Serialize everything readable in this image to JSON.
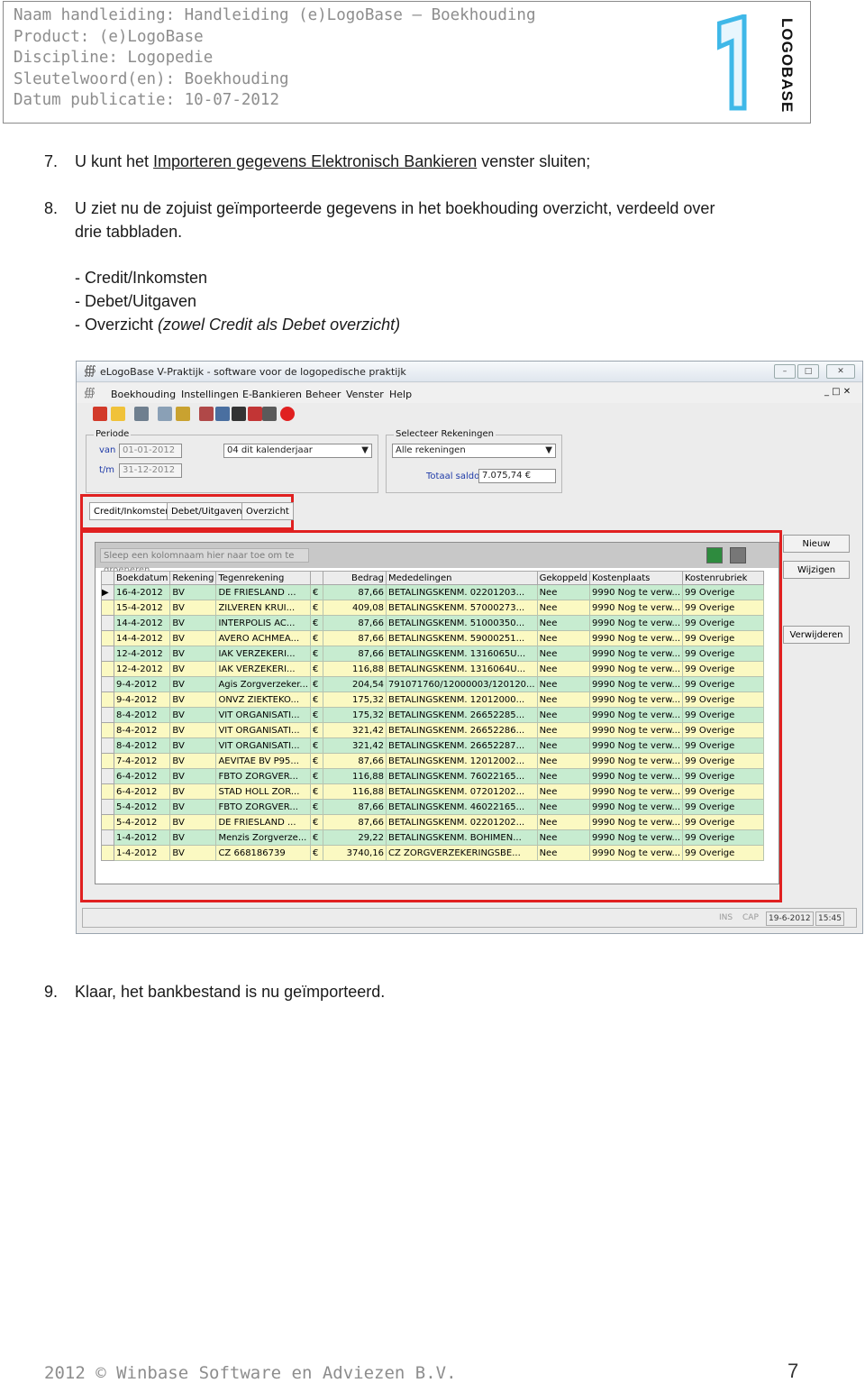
{
  "header": {
    "lines": [
      "Naam handleiding: Handleiding (e)LogoBase – Boekhouding",
      "Product: (e)LogoBase",
      "Discipline: Logopedie",
      "Sleutelwoord(en): Boekhouding",
      "Datum publicatie: 10-07-2012"
    ],
    "logo_text": "LOGOBASE"
  },
  "steps": {
    "s7_num": "7.",
    "s7_a": "U kunt het ",
    "s7_link": "Importeren gegevens Elektronisch Bankieren",
    "s7_b": " venster sluiten;",
    "s8_num": "8.",
    "s8_line1": "U ziet nu de zojuist geïmporteerde gegevens in het boekhouding overzicht, verdeeld over",
    "s8_line2": "drie tabbladen.",
    "bullet1": "- Credit/Inkomsten",
    "bullet2": "- Debet/Uitgaven",
    "bullet3_a": "- Overzicht ",
    "bullet3_b": "(zowel Credit als Debet overzicht)",
    "s9_num": "9.",
    "s9": "Klaar, het bankbestand is nu geïmporteerd."
  },
  "window": {
    "title": "eLogoBase V-Praktijk - software voor de logopedische praktijk",
    "menu": [
      "Boekhouding",
      "Instellingen",
      "E-Bankieren",
      "Beheer",
      "Venster",
      "Help"
    ],
    "periode_label": "Periode",
    "van_label": "van",
    "van_value": "01-01-2012",
    "tm_label": "t/m",
    "tm_value": "31-12-2012",
    "period_select": "04 dit kalenderjaar",
    "rek_label": "Selecteer Rekeningen",
    "rek_value": "Alle rekeningen",
    "saldo_label": "Totaal saldo",
    "saldo_value": "7.075,74 €",
    "tabs": [
      "Credit/Inkomsten",
      "Debet/Uitgaven",
      "Overzicht"
    ],
    "group_hint": "Sleep een kolomnaam hier naar toe om te groeperen",
    "columns": [
      "Boekdatum",
      "Rekening",
      "Tegenrekening",
      "",
      "Bedrag",
      "Mededelingen",
      "Gekoppeld",
      "Kostenplaats",
      "Kostenrubriek"
    ],
    "rows": [
      [
        "16-4-2012",
        "BV",
        "DE FRIESLAND ...",
        "€",
        "87,66",
        "BETALINGSKENM.  02201203...",
        "Nee",
        "9990 Nog te verw...",
        "99 Overige"
      ],
      [
        "15-4-2012",
        "BV",
        "ZILVEREN KRUI...",
        "€",
        "409,08",
        "BETALINGSKENM.  57000273...",
        "Nee",
        "9990 Nog te verw...",
        "99 Overige"
      ],
      [
        "14-4-2012",
        "BV",
        "INTERPOLIS AC...",
        "€",
        "87,66",
        "BETALINGSKENM.  51000350...",
        "Nee",
        "9990 Nog te verw...",
        "99 Overige"
      ],
      [
        "14-4-2012",
        "BV",
        "AVERO ACHMEA...",
        "€",
        "87,66",
        "BETALINGSKENM.  59000251...",
        "Nee",
        "9990 Nog te verw...",
        "99 Overige"
      ],
      [
        "12-4-2012",
        "BV",
        "IAK VERZEKERI...",
        "€",
        "87,66",
        "BETALINGSKENM.  1316065U...",
        "Nee",
        "9990 Nog te verw...",
        "99 Overige"
      ],
      [
        "12-4-2012",
        "BV",
        "IAK VERZEKERI...",
        "€",
        "116,88",
        "BETALINGSKENM.  1316064U...",
        "Nee",
        "9990 Nog te verw...",
        "99 Overige"
      ],
      [
        "9-4-2012",
        "BV",
        "Agis Zorgverzeker...",
        "€",
        "204,54",
        "791071760/12000003/120120...",
        "Nee",
        "9990 Nog te verw...",
        "99 Overige"
      ],
      [
        "9-4-2012",
        "BV",
        "ONVZ ZIEKTEKO...",
        "€",
        "175,32",
        "BETALINGSKENM.  12012000...",
        "Nee",
        "9990 Nog te verw...",
        "99 Overige"
      ],
      [
        "8-4-2012",
        "BV",
        "VIT ORGANISATI...",
        "€",
        "175,32",
        "BETALINGSKENM.  26652285...",
        "Nee",
        "9990 Nog te verw...",
        "99 Overige"
      ],
      [
        "8-4-2012",
        "BV",
        "VIT ORGANISATI...",
        "€",
        "321,42",
        "BETALINGSKENM.  26652286...",
        "Nee",
        "9990 Nog te verw...",
        "99 Overige"
      ],
      [
        "8-4-2012",
        "BV",
        "VIT ORGANISATI...",
        "€",
        "321,42",
        "BETALINGSKENM.  26652287...",
        "Nee",
        "9990 Nog te verw...",
        "99 Overige"
      ],
      [
        "7-4-2012",
        "BV",
        "AEVITAE BV P95...",
        "€",
        "87,66",
        "BETALINGSKENM.  12012002...",
        "Nee",
        "9990 Nog te verw...",
        "99 Overige"
      ],
      [
        "6-4-2012",
        "BV",
        "FBTO ZORGVER...",
        "€",
        "116,88",
        "BETALINGSKENM.  76022165...",
        "Nee",
        "9990 Nog te verw...",
        "99 Overige"
      ],
      [
        "6-4-2012",
        "BV",
        "STAD HOLL ZOR...",
        "€",
        "116,88",
        "BETALINGSKENM.  07201202...",
        "Nee",
        "9990 Nog te verw...",
        "99 Overige"
      ],
      [
        "5-4-2012",
        "BV",
        "FBTO ZORGVER...",
        "€",
        "87,66",
        "BETALINGSKENM.  46022165...",
        "Nee",
        "9990 Nog te verw...",
        "99 Overige"
      ],
      [
        "5-4-2012",
        "BV",
        "DE FRIESLAND ...",
        "€",
        "87,66",
        "BETALINGSKENM.  02201202...",
        "Nee",
        "9990 Nog te verw...",
        "99 Overige"
      ],
      [
        "1-4-2012",
        "BV",
        "Menzis Zorgverze...",
        "€",
        "29,22",
        "BETALINGSKENM.  BOHIMEN...",
        "Nee",
        "9990 Nog te verw...",
        "99 Overige"
      ],
      [
        "1-4-2012",
        "BV",
        "CZ 668186739",
        "€",
        "3740,16",
        "CZ ZORGVERZEKERINGSBE...",
        "Nee",
        "9990 Nog te verw...",
        "99 Overige"
      ]
    ],
    "buttons": {
      "nieuw": "Nieuw",
      "wijzigen": "Wijzigen",
      "verwijderen": "Verwijderen"
    },
    "status": {
      "ins": "INS",
      "cap": "CAP",
      "date": "19-6-2012",
      "time": "15:45"
    }
  },
  "footer": {
    "text": "2012 © Winbase Software en Adviezen B.V.",
    "page": "7"
  },
  "colors": {
    "highlight": "#e02020",
    "row_green": "#c7ecd0",
    "row_yellow": "#fbf9c2",
    "logo_cyan": "#3fb8e8"
  }
}
